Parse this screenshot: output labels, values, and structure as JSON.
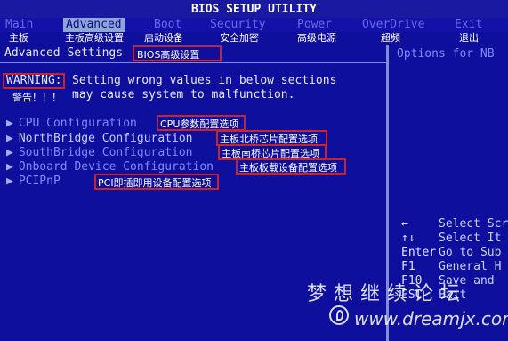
{
  "title": "BIOS SETUP UTILITY",
  "menu": {
    "items": [
      "Main",
      "Advanced",
      "Boot",
      "Security",
      "Power",
      "OverDrive",
      "Exit"
    ],
    "active": "Advanced"
  },
  "menu_cn": [
    "主板",
    "主板高级设置",
    "启动设备",
    "安全加密",
    "高级电源",
    "超频",
    "退出"
  ],
  "section": {
    "title": "Advanced Settings",
    "annotation": "BIOS高级设置"
  },
  "warning": {
    "label": "WARNING:",
    "label_cn": "警告！！！",
    "line1": "Setting wrong values in below sections",
    "line2": "may cause system to malfunction."
  },
  "options": [
    {
      "arrow": "▶",
      "label": "CPU Configuration",
      "annotation": "CPU参数配置选项"
    },
    {
      "arrow": "▶",
      "label": "NorthBridge Configuration",
      "annotation": "主板北桥芯片配置选项"
    },
    {
      "arrow": "▶",
      "label": "SouthBridge Configuration",
      "annotation": "主板南桥芯片配置选项"
    },
    {
      "arrow": "▶",
      "label": "Onboard Device Configuration",
      "annotation": "主板板载设备配置选项"
    },
    {
      "arrow": "▶",
      "label": "PCIPnP",
      "annotation": "PCI即插即用设备配置选项"
    }
  ],
  "side": {
    "title": "Options for NB",
    "help": [
      {
        "key": "←",
        "desc": "Select Scr"
      },
      {
        "key": "↑↓",
        "desc": "Select It"
      },
      {
        "key": "Enter",
        "desc": "Go to Sub"
      },
      {
        "key": "F1",
        "desc": "General H"
      },
      {
        "key": "F10",
        "desc": "Save and"
      },
      {
        "key": "ESC",
        "desc": "Exit"
      }
    ]
  },
  "watermark": {
    "line1": "梦想继续论坛",
    "line2": "www.dreamjx.com"
  }
}
